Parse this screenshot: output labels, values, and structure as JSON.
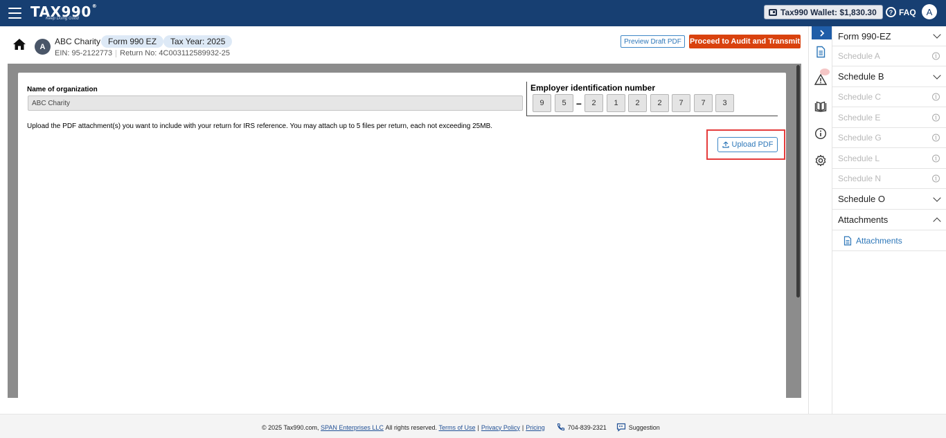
{
  "brand": {
    "logo": "TAX990",
    "logo_reg": "®",
    "tagline": "Keep Doing Good"
  },
  "topbar": {
    "wallet": "Tax990 Wallet: $1,830.30",
    "faq": "FAQ",
    "user_initial": "A"
  },
  "header": {
    "org_initial": "A",
    "org_name": "ABC Charity",
    "form_pill": "Form 990 EZ",
    "year_pill": "Tax Year: 2025",
    "ein": "EIN: 95-2122773",
    "return_no": "Return No: 4C003112589932-25",
    "preview_btn": "Preview Draft PDF",
    "proceed_btn": "Proceed to Audit and Transmit"
  },
  "form": {
    "org_label": "Name of organization",
    "org_value": "ABC Charity",
    "ein_label": "Employer identification number",
    "ein_digits": [
      "9",
      "5",
      "2",
      "1",
      "2",
      "2",
      "7",
      "7",
      "3"
    ],
    "ein_dash": "–",
    "upload_text": "Upload the PDF attachment(s) you want to include with your return for IRS reference. You may attach up to 5 files per return, each not exceeding 25MB.",
    "upload_btn": "Upload PDF"
  },
  "rail": {
    "icons": [
      "chevron-right-icon",
      "document-icon",
      "warning-icon",
      "book-icon",
      "info-icon",
      "gear-icon"
    ]
  },
  "sidebar": {
    "items": [
      {
        "label": "Form 990-EZ",
        "state": "expandable"
      },
      {
        "label": "Schedule A",
        "state": "disabled"
      },
      {
        "label": "Schedule B",
        "state": "expandable"
      },
      {
        "label": "Schedule C",
        "state": "disabled"
      },
      {
        "label": "Schedule E",
        "state": "disabled"
      },
      {
        "label": "Schedule G",
        "state": "disabled"
      },
      {
        "label": "Schedule L",
        "state": "disabled"
      },
      {
        "label": "Schedule N",
        "state": "disabled"
      },
      {
        "label": "Schedule O",
        "state": "expandable"
      },
      {
        "label": "Attachments",
        "state": "expanded"
      }
    ],
    "sub_item": "Attachments"
  },
  "footer": {
    "copyright": "© 2025 Tax990.com,",
    "company": "SPAN Enterprises LLC",
    "rights": "All rights reserved.",
    "terms": "Terms of Use",
    "privacy": "Privacy Policy",
    "pricing": "Pricing",
    "phone": "704-839-2321",
    "suggestion": "Suggestion"
  },
  "colors": {
    "brand": "#173f72",
    "accent": "#d9420e",
    "link": "#2c76b8",
    "highlight": "#e53b3b"
  }
}
